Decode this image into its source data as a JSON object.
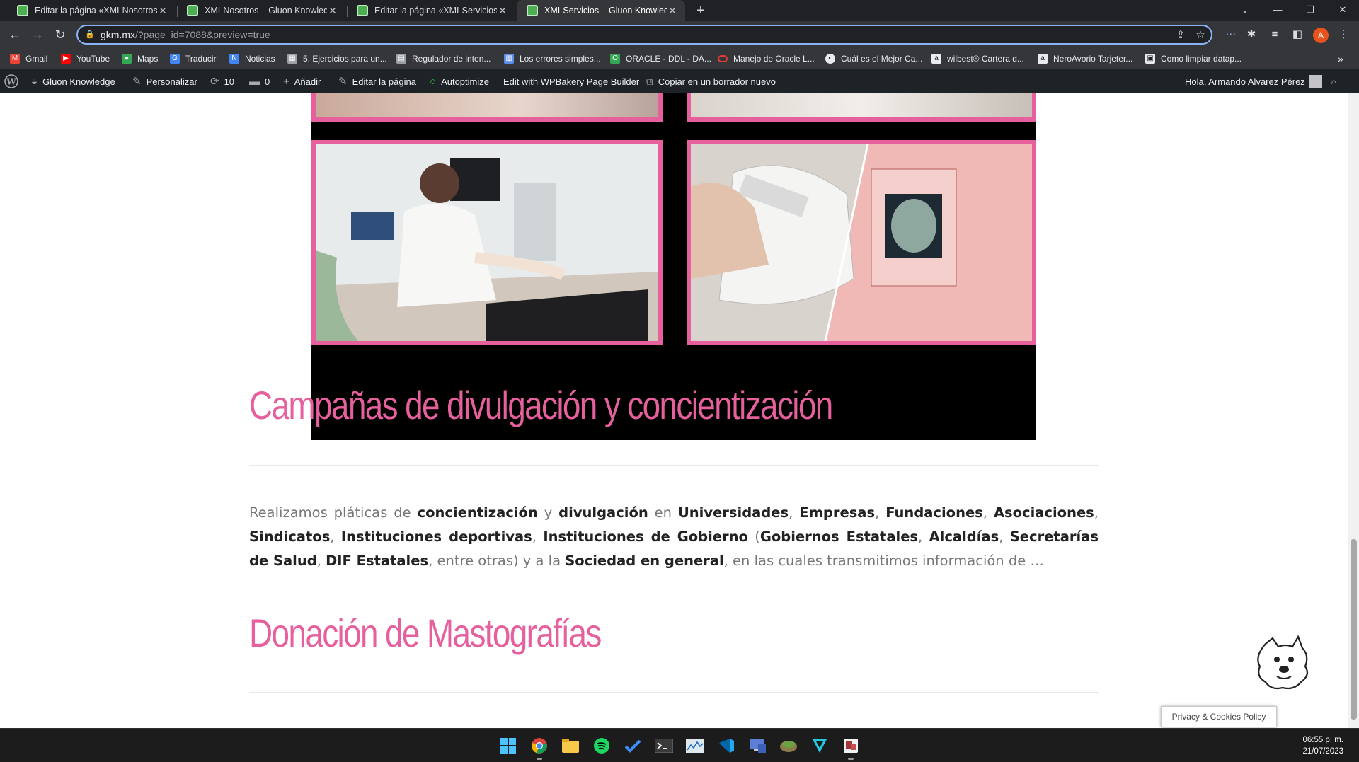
{
  "tabs": [
    {
      "title": "Editar la página «XMI-Nosotros» ‹ Gluon Knowledge",
      "active": false
    },
    {
      "title": "XMI-Nosotros – Gluon Knowledge",
      "active": false
    },
    {
      "title": "Editar la página «XMI-Servicios» ‹ Gluon Knowledge",
      "active": false
    },
    {
      "title": "XMI-Servicios – Gluon Knowledge",
      "active": true
    }
  ],
  "address": {
    "host": "gkm.mx",
    "path": "/?page_id=7088&preview=true"
  },
  "profile_initial": "A",
  "bookmarks": [
    {
      "label": "Gmail",
      "icon": "gmail-icon",
      "color": "#ea4335"
    },
    {
      "label": "YouTube",
      "icon": "youtube-icon",
      "color": "#ff0000"
    },
    {
      "label": "Maps",
      "icon": "maps-icon",
      "color": "#34a853"
    },
    {
      "label": "Traducir",
      "icon": "translate-icon",
      "color": "#4285f4"
    },
    {
      "label": "Noticias",
      "icon": "news-icon",
      "color": "#4285f4"
    },
    {
      "label": "5. Ejercicios para un...",
      "icon": "calendar-icon",
      "color": "#9aa0a6"
    },
    {
      "label": "Regulador de inten...",
      "icon": "page-icon",
      "color": "#9aa0a6"
    },
    {
      "label": "Los errores simples...",
      "icon": "page-icon",
      "color": "#5b8def"
    },
    {
      "label": "ORACLE - DDL - DA...",
      "icon": "oracle-icon",
      "color": "#34a853"
    },
    {
      "label": "Manejo de Oracle L...",
      "icon": "oracle-ring-icon",
      "color": "#e53935"
    },
    {
      "label": "Cuál es el Mejor Ca...",
      "icon": "globe-icon",
      "color": "#e8eaed"
    },
    {
      "label": "wilbest® Cartera d...",
      "icon": "amazon-icon",
      "color": "#e8eaed"
    },
    {
      "label": "NeroAvorio Tarjeter...",
      "icon": "amazon-icon",
      "color": "#e8eaed"
    },
    {
      "label": "Como limpiar datap...",
      "icon": "page-icon",
      "color": "#e8eaed"
    }
  ],
  "wpbar": {
    "site": "Gluon Knowledge",
    "customize": "Personalizar",
    "updates": "10",
    "comments": "0",
    "new": "Añadir",
    "edit": "Editar la página",
    "autoptimize": "Autoptimize",
    "wpbakery": "Edit with WPBakery Page Builder",
    "copy_draft": "Copiar en un borrador nuevo",
    "greeting": "Hola, Armando Alvarez Pérez"
  },
  "content": {
    "heading1": "Campañas de divulgación y concientización",
    "heading2": "Donación de Mastografías",
    "paragraph": [
      {
        "t": "Realizamos pláticas de ",
        "b": false
      },
      {
        "t": "concientización",
        "b": true
      },
      {
        "t": " y ",
        "b": false
      },
      {
        "t": "divulgación",
        "b": true
      },
      {
        "t": " en ",
        "b": false
      },
      {
        "t": "Universidades",
        "b": true
      },
      {
        "t": ", ",
        "b": false
      },
      {
        "t": "Empresas",
        "b": true
      },
      {
        "t": ", ",
        "b": false
      },
      {
        "t": "Fundaciones",
        "b": true
      },
      {
        "t": ", ",
        "b": false
      },
      {
        "t": "Asociaciones",
        "b": true
      },
      {
        "t": ", ",
        "b": false
      },
      {
        "t": "Sindicatos",
        "b": true
      },
      {
        "t": ", ",
        "b": false
      },
      {
        "t": "Instituciones deportivas",
        "b": true
      },
      {
        "t": ", ",
        "b": false
      },
      {
        "t": "Instituciones de Gobierno",
        "b": true
      },
      {
        "t": " (",
        "b": false
      },
      {
        "t": "Gobiernos Estatales",
        "b": true
      },
      {
        "t": ", ",
        "b": false
      },
      {
        "t": "Alcaldías",
        "b": true
      },
      {
        "t": ", ",
        "b": false
      },
      {
        "t": "Secretarías de Salud",
        "b": true
      },
      {
        "t": ", ",
        "b": false
      },
      {
        "t": "DIF Estatales",
        "b": true
      },
      {
        "t": ", entre otras) y a la ",
        "b": false
      },
      {
        "t": "Sociedad en general",
        "b": true
      },
      {
        "t": ", en las cuales transmitimos información de  …",
        "b": false
      }
    ]
  },
  "cookie_policy": "Privacy & Cookies Policy",
  "colors": {
    "accent": "#e6609d",
    "wpbar": "#1d2327",
    "chrome": "#35363a"
  },
  "taskbar": {
    "apps": [
      "windows-start-icon",
      "chrome-icon",
      "file-explorer-icon",
      "spotify-icon",
      "todo-icon",
      "terminal-icon",
      "resource-monitor-icon",
      "vscode-icon",
      "remote-desktop-icon",
      "dbeaver-icon",
      "vpn-icon",
      "access-icon"
    ],
    "time": "06:55 p. m.",
    "date": "21/07/2023"
  }
}
